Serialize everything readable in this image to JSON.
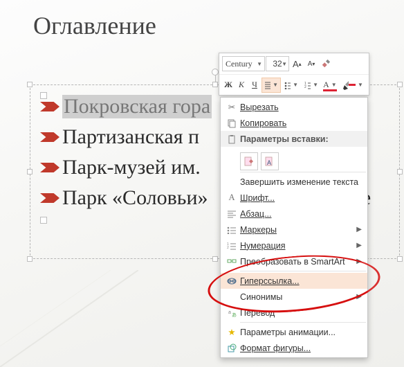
{
  "slide": {
    "title": "Оглавление",
    "bullets": [
      {
        "text": "Покровская гора",
        "highlighted": true
      },
      {
        "text": "Партизанская п",
        "tail": ""
      },
      {
        "text": "Парк-музей им.",
        "tail": ""
      },
      {
        "text": "Парк «Соловьи»",
        "tail": "сме"
      }
    ]
  },
  "mini_toolbar": {
    "font_name": "Century",
    "font_size": "32",
    "grow": "A",
    "shrink": "A",
    "bold": "Ж",
    "italic": "К",
    "underline": "Ч",
    "font_color_letter": "A"
  },
  "context_menu": {
    "cut": "Вырезать",
    "copy": "Копировать",
    "paste_header": "Параметры вставки:",
    "finish_edit": "Завершить изменение текста",
    "font": "Шрифт...",
    "paragraph": "Абзац...",
    "bullets": "Маркеры",
    "numbering": "Нумерация",
    "smartart": "Преобразовать в SmartArt",
    "hyperlink": "Гиперссылка...",
    "synonyms": "Синонимы",
    "translate": "Перевод",
    "anim": "Параметры анимации...",
    "format_shape": "Формат фигуры..."
  }
}
